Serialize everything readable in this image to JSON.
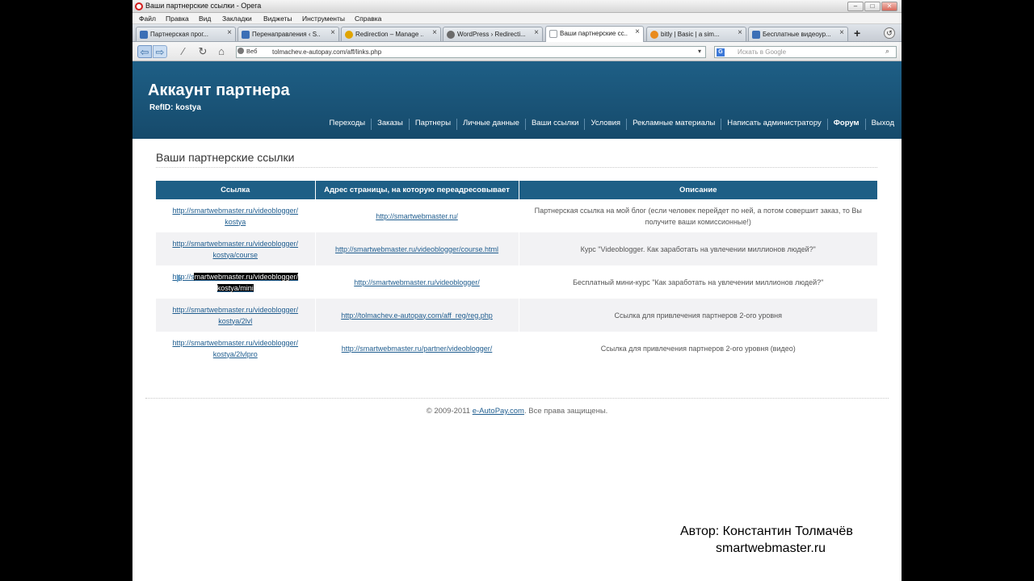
{
  "window": {
    "title": "Ваши партнерские ссылки - Opera",
    "min_label": "–",
    "max_label": "□",
    "close_label": "✕"
  },
  "menu": [
    "Файл",
    "Правка",
    "Вид",
    "Закладки",
    "Виджеты",
    "Инструменты",
    "Справка"
  ],
  "tabs": [
    {
      "label": "Партнерская прог...",
      "icon": "bar-chart-icon",
      "color": "#3b6fb6"
    },
    {
      "label": "Перенаправления ‹ S...",
      "icon": "bar-chart-icon",
      "color": "#3b6fb6"
    },
    {
      "label": "Redirection – Manage ...",
      "icon": "star-icon",
      "color": "#e0a400"
    },
    {
      "label": "WordPress › Redirecti...",
      "icon": "wordpress-icon",
      "color": "#6b6b6b"
    },
    {
      "label": "Ваши партнерские сс...",
      "icon": "page-icon",
      "color": "#9aa0a6"
    },
    {
      "label": "bitly | Basic | a sim...",
      "icon": "blowfish-icon",
      "color": "#e98b1e"
    },
    {
      "label": "Бесплатные видеоур...",
      "icon": "bar-chart-icon",
      "color": "#3b6fb6"
    }
  ],
  "newtab_label": "+",
  "address": {
    "web_tag": "Веб",
    "url": "tolmachev.e-autopay.com/aff/links.php",
    "search_placeholder": "Искать в Google",
    "google_label": "G"
  },
  "site": {
    "title": "Аккаунт партнера",
    "refid": "RefID: kostya",
    "nav": [
      "Переходы",
      "Заказы",
      "Партнеры",
      "Личные данные",
      "Ваши ссылки",
      "Условия",
      "Рекламные материалы",
      "Написать администратору",
      "Форум",
      "Выход"
    ]
  },
  "section_title": "Ваши партнерские ссылки",
  "table": {
    "headers": [
      "Ссылка",
      "Адрес страницы, на которую переадресовывает",
      "Описание"
    ],
    "rows": [
      {
        "link1": "http://smartwebmaster.ru/videoblogger/",
        "link2": "kostya",
        "target": "http://smartwebmaster.ru/",
        "desc": "Партнерская ссылка на мой блог (если человек перейдет по ней, а потом совершит заказ, то Вы получите ваши комиссионные!)"
      },
      {
        "link1": "http://smartwebmaster.ru/videoblogger/",
        "link2": "kostya/course",
        "target": "http://smartwebmaster.ru/videoblogger/course.html",
        "desc": "Курс \"Videoblogger. Как заработать на увлечении миллионов людей?\""
      },
      {
        "link1a": "htt",
        "link1b": "p://s",
        "link1c": "martwebmaster.ru/videoblogger/",
        "link2": "kostya/mini",
        "target": "http://smartwebmaster.ru/videoblogger/",
        "desc": "Бесплатный мини-курс \"Как заработать на увлечении миллионов людей?\""
      },
      {
        "link1": "http://smartwebmaster.ru/videoblogger/",
        "link2": "kostya/2lvl",
        "target": "http://tolmachev.e-autopay.com/aff_reg/reg.php",
        "desc": "Ссылка для привлечения партнеров 2-ого уровня"
      },
      {
        "link1": "http://smartwebmaster.ru/videoblogger/",
        "link2": "kostya/2lvlpro",
        "target": "http://smartwebmaster.ru/partner/videoblogger/",
        "desc": "Ссылка для привлечения партнеров 2-ого уровня (видео)"
      }
    ]
  },
  "footer": {
    "pre": "© 2009-2011 ",
    "link": "e-AutoPay.com",
    "post": ". Все права защищены."
  },
  "overlay": {
    "author": "Автор: Константин Толмачёв",
    "site": "smartwebmaster.ru"
  }
}
